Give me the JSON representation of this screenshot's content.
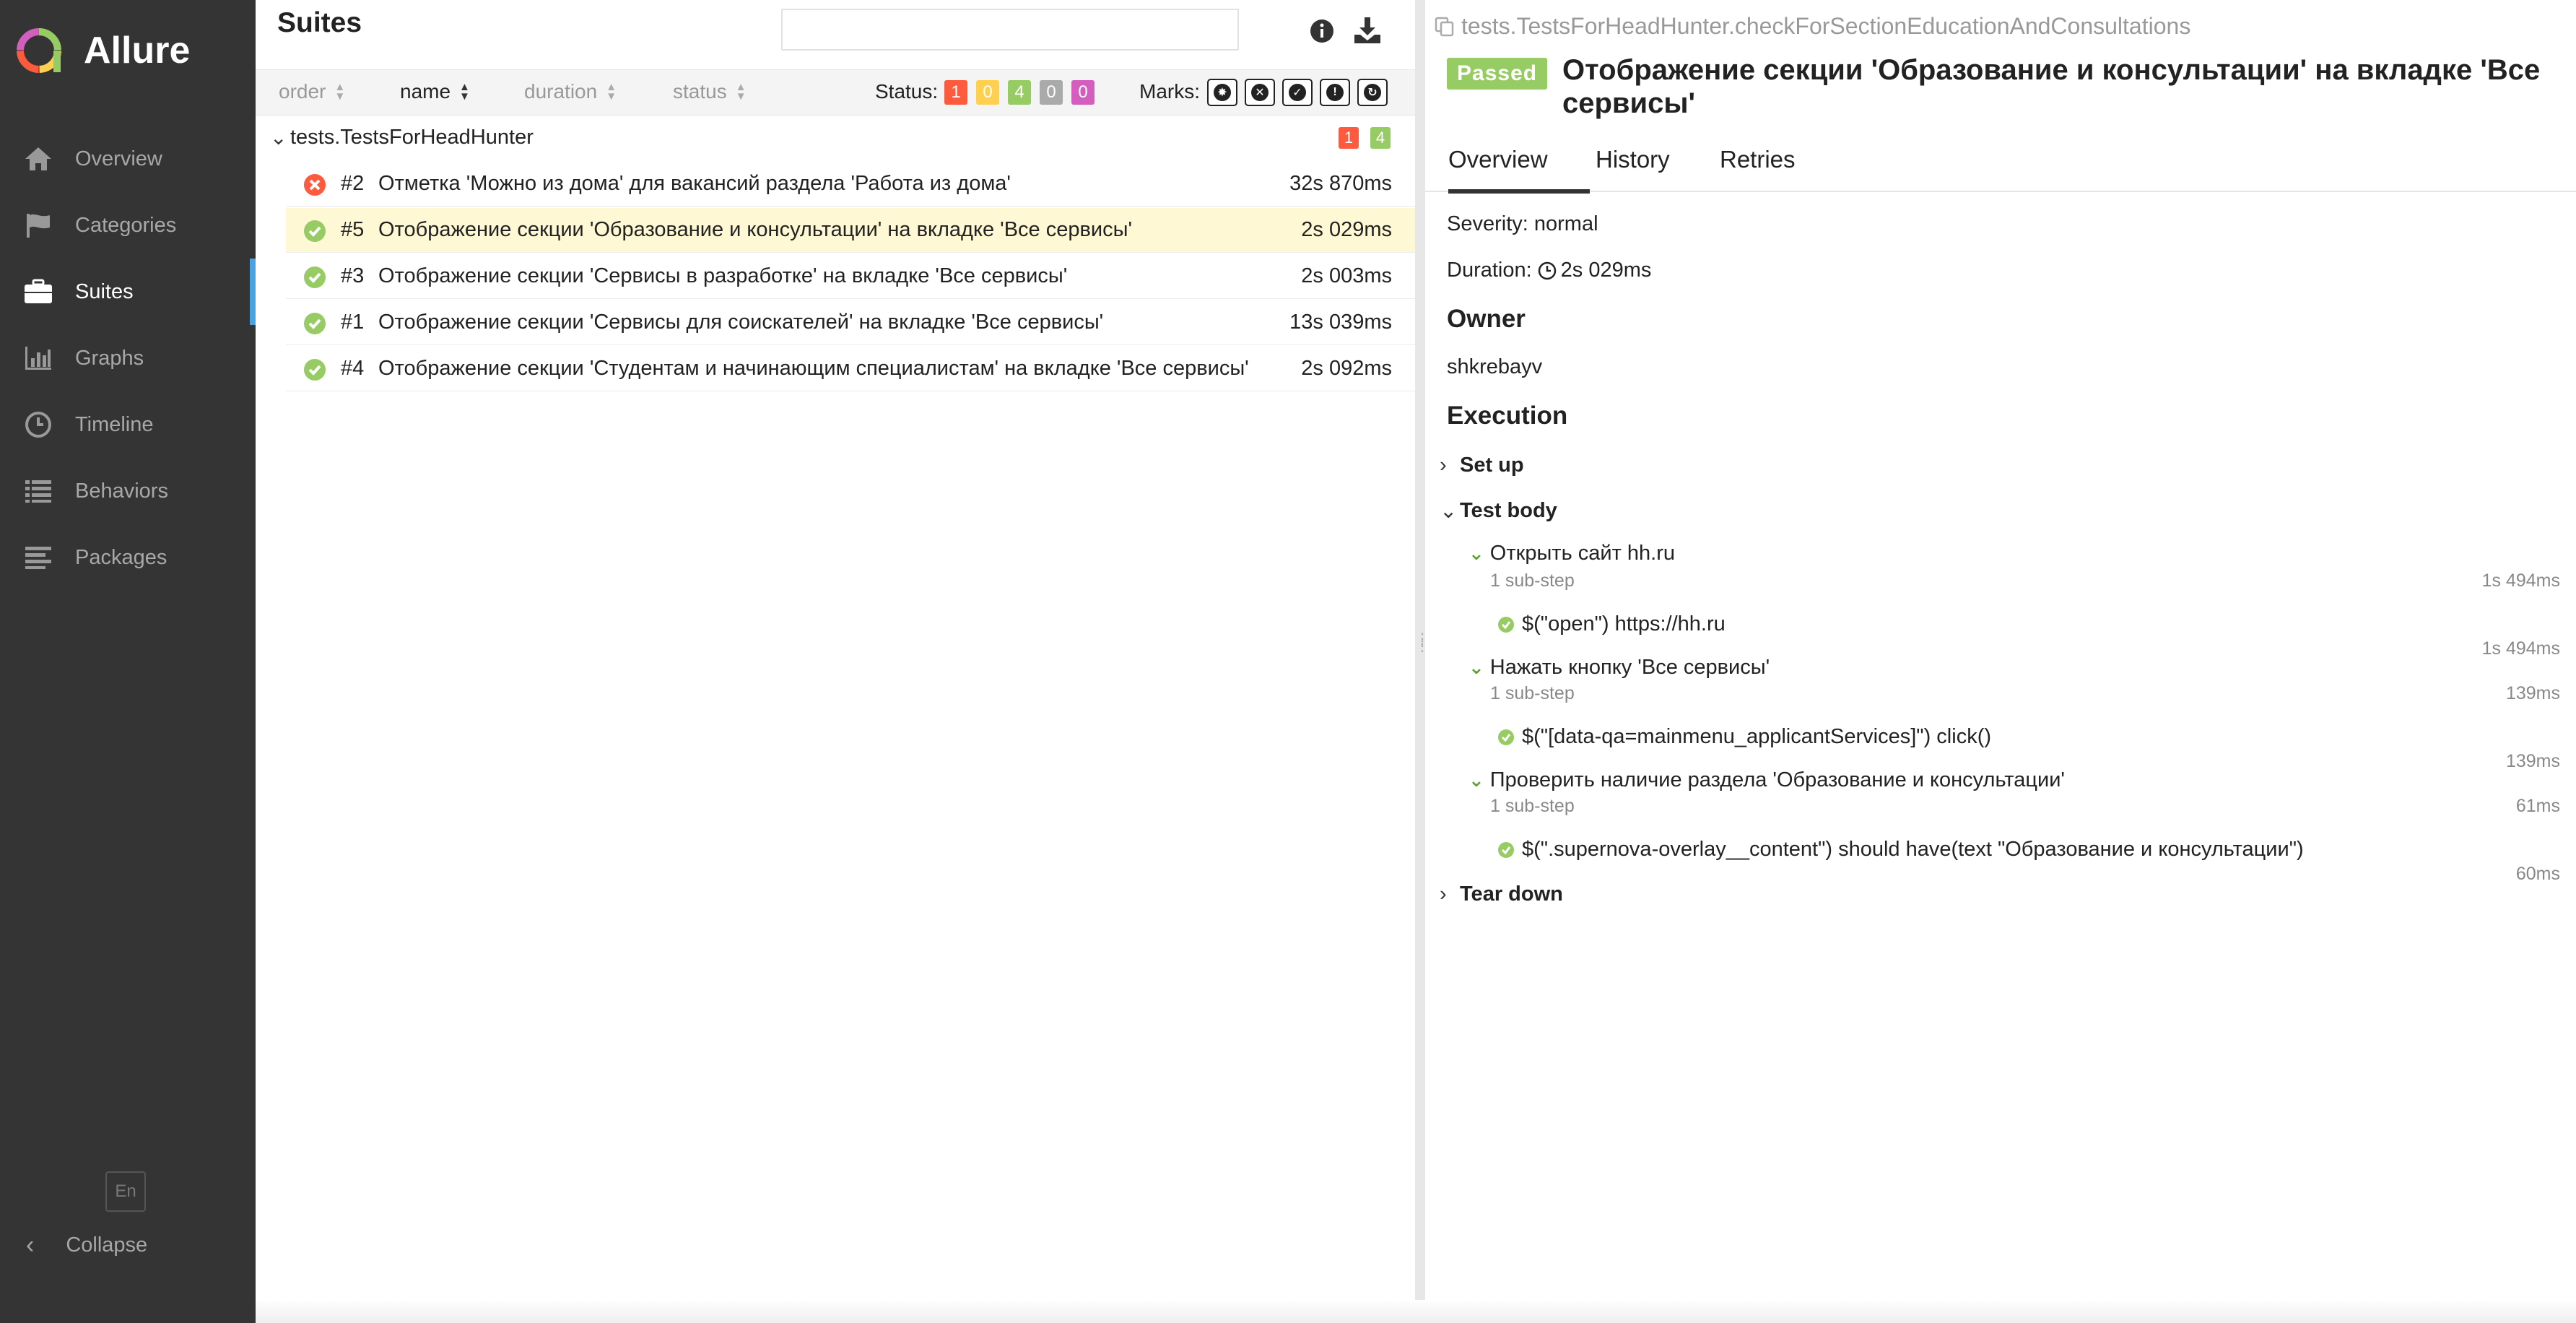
{
  "sidebar": {
    "brand": "Allure",
    "items": [
      {
        "label": "Overview",
        "icon": "home-icon"
      },
      {
        "label": "Categories",
        "icon": "flag-icon"
      },
      {
        "label": "Suites",
        "icon": "briefcase-icon",
        "active": true
      },
      {
        "label": "Graphs",
        "icon": "bar-chart-icon"
      },
      {
        "label": "Timeline",
        "icon": "clock-icon"
      },
      {
        "label": "Behaviors",
        "icon": "list-icon"
      },
      {
        "label": "Packages",
        "icon": "align-left-icon"
      }
    ],
    "language": "En",
    "collapse_label": "Collapse"
  },
  "suites_pane": {
    "title": "Suites",
    "search_value": "",
    "sort_columns": [
      "order",
      "name",
      "duration",
      "status"
    ],
    "active_sort": "name",
    "status_label": "Status:",
    "status_counts": [
      {
        "status": "failed",
        "count": "1",
        "color": "#fd5a3e"
      },
      {
        "status": "broken",
        "count": "0",
        "color": "#ffd050"
      },
      {
        "status": "passed",
        "count": "4",
        "color": "#97cc64"
      },
      {
        "status": "skipped",
        "count": "0",
        "color": "#aaaaaa"
      },
      {
        "status": "unknown",
        "count": "0",
        "color": "#d35ebe"
      }
    ],
    "marks_label": "Marks:",
    "group": {
      "name": "tests.TestsForHeadHunter",
      "failed_count": "1",
      "passed_count": "4"
    },
    "tests": [
      {
        "num": "#2",
        "name": "Отметка 'Можно из дома' для вакансий раздела 'Работа из дома'",
        "duration": "32s 870ms",
        "status": "failed"
      },
      {
        "num": "#5",
        "name": "Отображение секции 'Образование и консультации' на вкладке 'Все сервисы'",
        "duration": "2s 029ms",
        "status": "passed",
        "selected": true
      },
      {
        "num": "#3",
        "name": "Отображение секции 'Сервисы в разработке' на вкладке 'Все сервисы'",
        "duration": "2s 003ms",
        "status": "passed"
      },
      {
        "num": "#1",
        "name": "Отображение секции 'Сервисы для соискателей' на вкладке 'Все сервисы'",
        "duration": "13s 039ms",
        "status": "passed"
      },
      {
        "num": "#4",
        "name": "Отображение секции 'Студентам и начинающим специалистам' на вкладке 'Все сервисы'",
        "duration": "2s 092ms",
        "status": "passed"
      }
    ]
  },
  "details": {
    "full_name": "tests.TestsForHeadHunter.checkForSectionEducationAndConsultations",
    "status_badge": "Passed",
    "title": "Отображение секции 'Образование и консультации' на вкладке 'Все сервисы'",
    "tabs": [
      "Overview",
      "History",
      "Retries"
    ],
    "severity": "Severity: normal",
    "duration_prefix": "Duration:",
    "duration": "2s 029ms",
    "owner_heading": "Owner",
    "owner": "shkrebayv",
    "execution_heading": "Execution",
    "setup_label": "Set up",
    "test_body_label": "Test body",
    "teardown_label": "Tear down",
    "steps": [
      {
        "name": "Открыть сайт hh.ru",
        "substeps": "1 sub-step",
        "duration": "1s 494ms",
        "child": "$(\"open\") https://hh.ru",
        "child_duration": "1s 494ms"
      },
      {
        "name": "Нажать кнопку 'Все сервисы'",
        "substeps": "1 sub-step",
        "duration": "139ms",
        "child": "$(\"[data-qa=mainmenu_applicantServices]\") click()",
        "child_duration": "139ms"
      },
      {
        "name": "Проверить наличие раздела 'Образование и консультации'",
        "substeps": "1 sub-step",
        "duration": "61ms",
        "child": "$(\".supernova-overlay__content\") should have(text \"Образование и консультации\")",
        "child_duration": "60ms"
      }
    ]
  }
}
